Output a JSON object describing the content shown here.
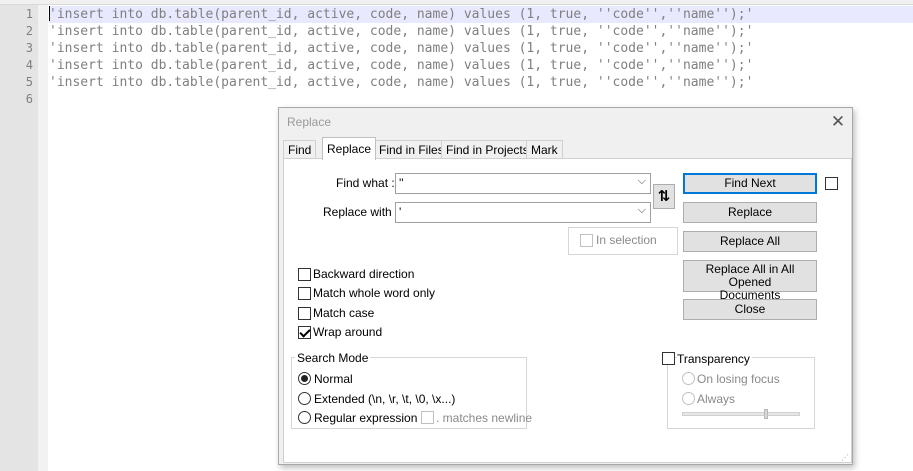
{
  "editor": {
    "line_numbers": [
      "1",
      "2",
      "3",
      "4",
      "5",
      "6"
    ],
    "lines": [
      "'insert into db.table(parent_id, active, code, name) values (1, true, ''code'',''name'');'",
      "'insert into db.table(parent_id, active, code, name) values (1, true, ''code'',''name'');'",
      "'insert into db.table(parent_id, active, code, name) values (1, true, ''code'',''name'');'",
      "'insert into db.table(parent_id, active, code, name) values (1, true, ''code'',''name'');'",
      "'insert into db.table(parent_id, active, code, name) values (1, true, ''code'',''name'');'",
      ""
    ]
  },
  "dialog": {
    "title": "Replace",
    "close_glyph": "✕",
    "tabs": [
      "Find",
      "Replace",
      "Find in Files",
      "Find in Projects",
      "Mark"
    ],
    "active_tab": "Replace",
    "find_label": "Find what :",
    "find_value": "''",
    "replace_label": "Replace with :",
    "replace_value": "'",
    "dropdown_glyph": "⌵",
    "swap_glyph": "⇅",
    "in_selection_label": "In selection",
    "buttons": {
      "find_next": "Find Next",
      "replace": "Replace",
      "replace_all": "Replace All",
      "replace_all_opened_line1": "Replace All in All Opened",
      "replace_all_opened_line2": "Documents",
      "close": "Close"
    },
    "options": [
      {
        "label": "Backward direction",
        "checked": false
      },
      {
        "label": "Match whole word only",
        "checked": false
      },
      {
        "label": "Match case",
        "checked": false
      },
      {
        "label": "Wrap around",
        "checked": true
      }
    ],
    "search_mode": {
      "title": "Search Mode",
      "options": [
        {
          "label": "Normal",
          "checked": true
        },
        {
          "label": "Extended (\\n, \\r, \\t, \\0, \\x...)",
          "checked": false
        },
        {
          "label": "Regular expression",
          "checked": false
        }
      ],
      "matches_newline_label": ". matches newline"
    },
    "transparency": {
      "label": "Transparency",
      "on_losing_focus": "On losing focus",
      "always": "Always"
    }
  }
}
